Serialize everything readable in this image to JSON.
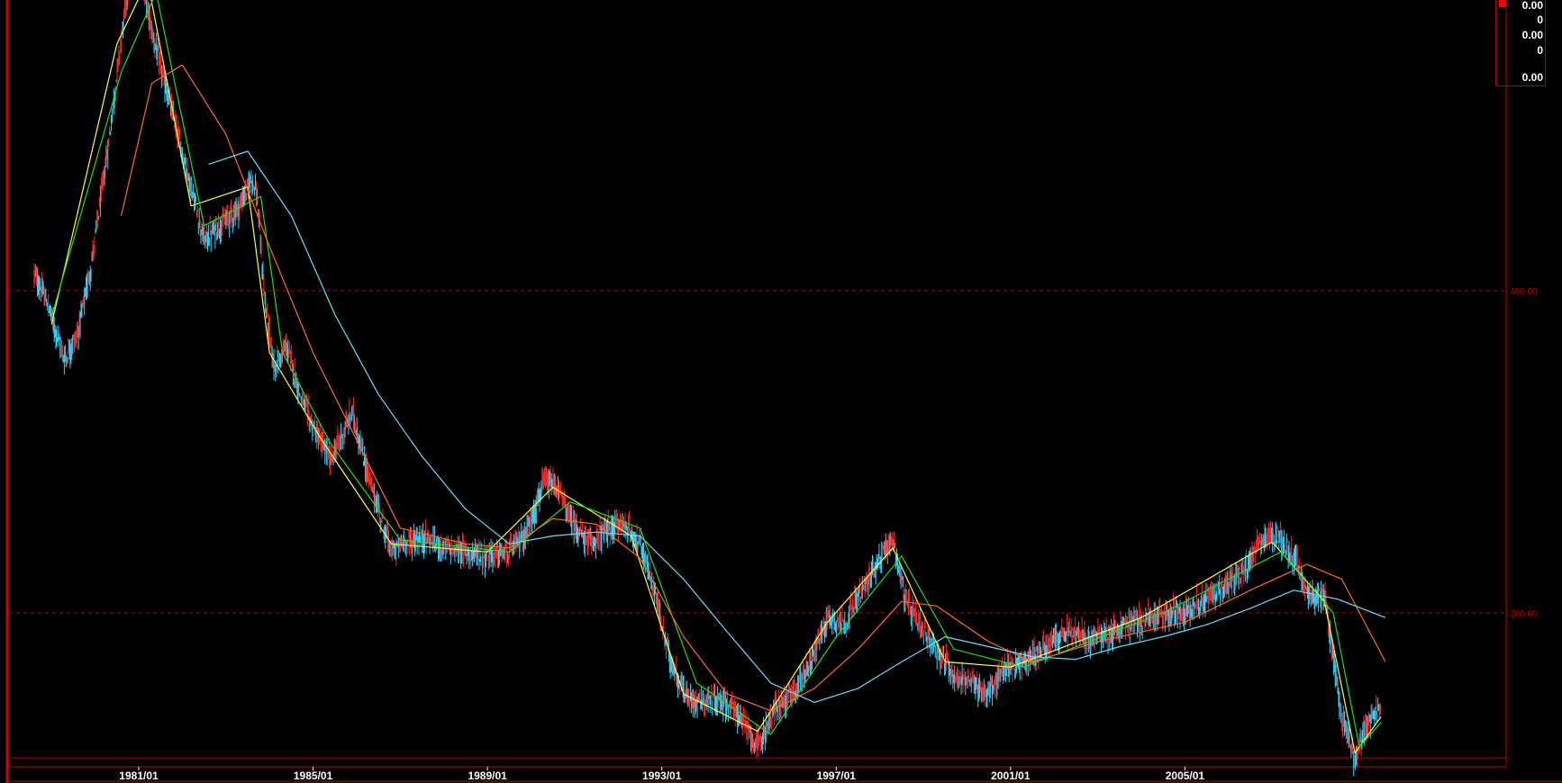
{
  "chart_data": {
    "type": "candlestick",
    "x_tick_labels": [
      "1981/01",
      "1985/01",
      "1989/01",
      "1993/01",
      "1997/01",
      "2001/01",
      "2005/01"
    ],
    "x_range": [
      1978.5,
      2009.6
    ],
    "y_tick_labels": [
      "400.00",
      "200.00"
    ],
    "ylim": [
      130,
      900
    ],
    "y_scale": "log",
    "grid": "horizontal dashed at tick levels",
    "colors": {
      "background": "#000000",
      "up_candle": "#ff2a2a",
      "down_candle": "#33d6ff",
      "ma_short": "#ffff44",
      "ma_mid": "#22dd22",
      "ma_long": "#ff6a2a",
      "ma_longest": "#66e0ff",
      "grid": "#c00000",
      "axis_text": "#ffffff"
    },
    "price_series": {
      "name": "",
      "points": [
        [
          1978.6,
          415
        ],
        [
          1978.9,
          390
        ],
        [
          1979.3,
          345
        ],
        [
          1979.6,
          365
        ],
        [
          1979.9,
          420
        ],
        [
          1980.3,
          545
        ],
        [
          1980.6,
          690
        ],
        [
          1980.9,
          840
        ],
        [
          1981.1,
          770
        ],
        [
          1981.3,
          700
        ],
        [
          1981.7,
          600
        ],
        [
          1982.1,
          520
        ],
        [
          1982.5,
          445
        ],
        [
          1982.9,
          462
        ],
        [
          1983.3,
          478
        ],
        [
          1983.6,
          510
        ],
        [
          1983.7,
          495
        ],
        [
          1983.9,
          390
        ],
        [
          1984.1,
          340
        ],
        [
          1984.4,
          355
        ],
        [
          1984.7,
          320
        ],
        [
          1985.0,
          298
        ],
        [
          1985.4,
          278
        ],
        [
          1985.7,
          295
        ],
        [
          1985.9,
          308
        ],
        [
          1986.2,
          275
        ],
        [
          1986.5,
          250
        ],
        [
          1986.8,
          228
        ],
        [
          1987.1,
          233
        ],
        [
          1987.6,
          235
        ],
        [
          1988.0,
          230
        ],
        [
          1988.5,
          228
        ],
        [
          1989.0,
          226
        ],
        [
          1989.5,
          228
        ],
        [
          1989.9,
          238
        ],
        [
          1990.3,
          265
        ],
        [
          1990.6,
          262
        ],
        [
          1990.9,
          245
        ],
        [
          1991.3,
          232
        ],
        [
          1991.7,
          238
        ],
        [
          1992.1,
          243
        ],
        [
          1992.5,
          232
        ],
        [
          1992.8,
          212
        ],
        [
          1993.2,
          180
        ],
        [
          1993.6,
          166
        ],
        [
          1994.0,
          166
        ],
        [
          1994.5,
          165
        ],
        [
          1994.8,
          160
        ],
        [
          1995.2,
          150
        ],
        [
          1995.6,
          163
        ],
        [
          1996.0,
          168
        ],
        [
          1996.4,
          180
        ],
        [
          1996.8,
          198
        ],
        [
          1997.2,
          196
        ],
        [
          1997.6,
          210
        ],
        [
          1998.0,
          225
        ],
        [
          1998.3,
          234
        ],
        [
          1998.6,
          205
        ],
        [
          1998.9,
          195
        ],
        [
          1999.3,
          185
        ],
        [
          1999.7,
          175
        ],
        [
          2000.1,
          172
        ],
        [
          2000.5,
          168
        ],
        [
          2000.9,
          178
        ],
        [
          2001.3,
          180
        ],
        [
          2001.8,
          186
        ],
        [
          2002.3,
          192
        ],
        [
          2002.8,
          189
        ],
        [
          2003.3,
          192
        ],
        [
          2003.8,
          196
        ],
        [
          2004.3,
          198
        ],
        [
          2004.8,
          200
        ],
        [
          2005.3,
          204
        ],
        [
          2005.8,
          210
        ],
        [
          2006.3,
          218
        ],
        [
          2006.8,
          234
        ],
        [
          2007.1,
          236
        ],
        [
          2007.5,
          226
        ],
        [
          2007.8,
          208
        ],
        [
          2008.2,
          207
        ],
        [
          2008.6,
          160
        ],
        [
          2008.9,
          146
        ],
        [
          2009.2,
          158
        ],
        [
          2009.5,
          163
        ]
      ]
    },
    "moving_averages": [
      {
        "name": "",
        "color": "ma_short",
        "points": [
          [
            1979,
            372
          ],
          [
            1980.5,
            680
          ],
          [
            1981.2,
            780
          ],
          [
            1982.2,
            480
          ],
          [
            1983.5,
            500
          ],
          [
            1984.0,
            350
          ],
          [
            1985.2,
            290
          ],
          [
            1986.8,
            232
          ],
          [
            1989,
            228
          ],
          [
            1990.5,
            262
          ],
          [
            1992.3,
            236
          ],
          [
            1993.5,
            168
          ],
          [
            1995.2,
            155
          ],
          [
            1996.8,
            196
          ],
          [
            1998.3,
            230
          ],
          [
            1999.5,
            180
          ],
          [
            2001,
            178
          ],
          [
            2004,
            198
          ],
          [
            2007.0,
            233
          ],
          [
            2008.2,
            205
          ],
          [
            2008.9,
            148
          ],
          [
            2009.5,
            160
          ]
        ]
      },
      {
        "name": "",
        "color": "ma_mid",
        "points": [
          [
            1979,
            378
          ],
          [
            1980.6,
            640
          ],
          [
            1981.4,
            760
          ],
          [
            1982.5,
            460
          ],
          [
            1983.8,
            490
          ],
          [
            1984.3,
            350
          ],
          [
            1985.4,
            288
          ],
          [
            1987,
            234
          ],
          [
            1989.5,
            228
          ],
          [
            1990.9,
            254
          ],
          [
            1992.5,
            240
          ],
          [
            1993.8,
            172
          ],
          [
            1995.5,
            154
          ],
          [
            1997,
            190
          ],
          [
            1998.5,
            226
          ],
          [
            1999.7,
            185
          ],
          [
            2001.3,
            178
          ],
          [
            2004.5,
            200
          ],
          [
            2007.2,
            228
          ],
          [
            2008.4,
            200
          ],
          [
            2009.0,
            150
          ],
          [
            2009.5,
            158
          ]
        ]
      },
      {
        "name": "",
        "color": "ma_long",
        "points": [
          [
            1980.6,
            470
          ],
          [
            1981.3,
            625
          ],
          [
            1982.0,
            650
          ],
          [
            1983.0,
            560
          ],
          [
            1984.0,
            440
          ],
          [
            1985.0,
            350
          ],
          [
            1986.0,
            290
          ],
          [
            1987.0,
            240
          ],
          [
            1988.5,
            232
          ],
          [
            1989.5,
            230
          ],
          [
            1990.5,
            245
          ],
          [
            1991.5,
            242
          ],
          [
            1992.5,
            225
          ],
          [
            1993.5,
            190
          ],
          [
            1994.5,
            168
          ],
          [
            1995.5,
            162
          ],
          [
            1996.5,
            170
          ],
          [
            1997.5,
            185
          ],
          [
            1998.5,
            205
          ],
          [
            1999.3,
            203
          ],
          [
            2000.5,
            188
          ],
          [
            2001.5,
            180
          ],
          [
            2003,
            188
          ],
          [
            2005,
            196
          ],
          [
            2006.5,
            210
          ],
          [
            2007.8,
            222
          ],
          [
            2008.6,
            215
          ],
          [
            2009.6,
            180
          ]
        ]
      },
      {
        "name": "",
        "color": "ma_longest",
        "points": [
          [
            1982.6,
            525
          ],
          [
            1983.5,
            540
          ],
          [
            1984.5,
            470
          ],
          [
            1985.5,
            380
          ],
          [
            1986.5,
            320
          ],
          [
            1987.5,
            280
          ],
          [
            1988.5,
            250
          ],
          [
            1989.5,
            232
          ],
          [
            1990.5,
            236
          ],
          [
            1991.5,
            238
          ],
          [
            1992.5,
            236
          ],
          [
            1993.5,
            215
          ],
          [
            1994.5,
            192
          ],
          [
            1995.5,
            172
          ],
          [
            1996.5,
            165
          ],
          [
            1997.5,
            170
          ],
          [
            1998.5,
            180
          ],
          [
            1999.5,
            190
          ],
          [
            2000.5,
            186
          ],
          [
            2001.5,
            182
          ],
          [
            2002.5,
            181
          ],
          [
            2003.5,
            186
          ],
          [
            2004.5,
            190
          ],
          [
            2005.5,
            195
          ],
          [
            2006.5,
            202
          ],
          [
            2007.5,
            210
          ],
          [
            2008.5,
            206
          ],
          [
            2009.6,
            198
          ]
        ]
      }
    ]
  },
  "info_panel": {
    "values": [
      "0.00",
      "0",
      "0.00",
      "0",
      "0.00"
    ]
  }
}
